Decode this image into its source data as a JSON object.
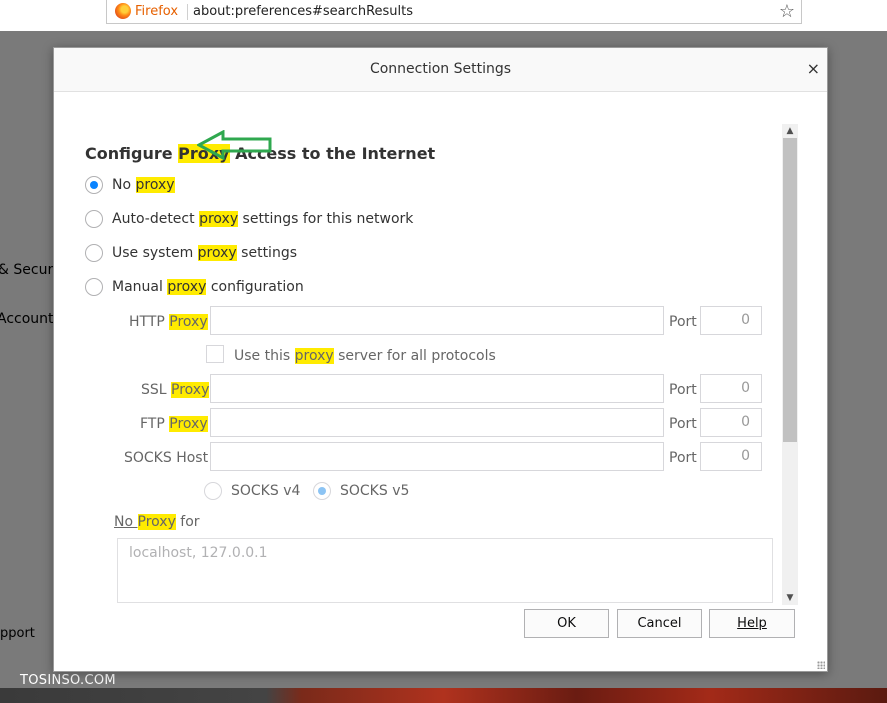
{
  "browser": {
    "brand": "Firefox",
    "url": "about:preferences#searchResults"
  },
  "background": {
    "sidebar_fragments": [
      "& Secur",
      "Account",
      "pport"
    ],
    "watermark": "TOSINSO.COM"
  },
  "dialog": {
    "title": "Connection Settings",
    "close_glyph": "×",
    "heading": {
      "pre": "Configure ",
      "hl": "Proxy",
      "post": " Access to the Internet"
    },
    "radios": [
      {
        "pre": "No ",
        "hl": "proxy",
        "post": "",
        "checked": true
      },
      {
        "pre": "Auto-detect ",
        "hl": "proxy",
        "post": " settings for this network",
        "checked": false
      },
      {
        "pre": "Use system ",
        "hl": "proxy",
        "post": " settings",
        "checked": false
      },
      {
        "pre": "Manual ",
        "hl": "proxy",
        "post": " configuration",
        "checked": false
      }
    ],
    "http": {
      "pre": "HTTP ",
      "hl": "Proxy",
      "port_label": "Port",
      "port": "0"
    },
    "use_all": {
      "pre": "Use this ",
      "hl": "proxy",
      "post": " server for all protocols"
    },
    "ssl": {
      "pre": "SSL ",
      "hl": "Proxy",
      "port_label": "Port",
      "port": "0"
    },
    "ftp": {
      "pre": "FTP ",
      "hl": "Proxy",
      "port_label": "Port",
      "port": "0"
    },
    "socks": {
      "label": "SOCKS Host",
      "port_label": "Port",
      "port": "0"
    },
    "socks_v4": "SOCKS v4",
    "socks_v5": "SOCKS v5",
    "no_proxy": {
      "pre": "No ",
      "hl": "Proxy",
      "post": " for"
    },
    "no_proxy_placeholder": "localhost, 127.0.0.1",
    "buttons": {
      "ok": "OK",
      "cancel": "Cancel",
      "help": "Help"
    },
    "accent_color": "#0a84ff",
    "highlight_color": "#ffeb00",
    "annotation_arrow_color": "#2fa84f"
  }
}
